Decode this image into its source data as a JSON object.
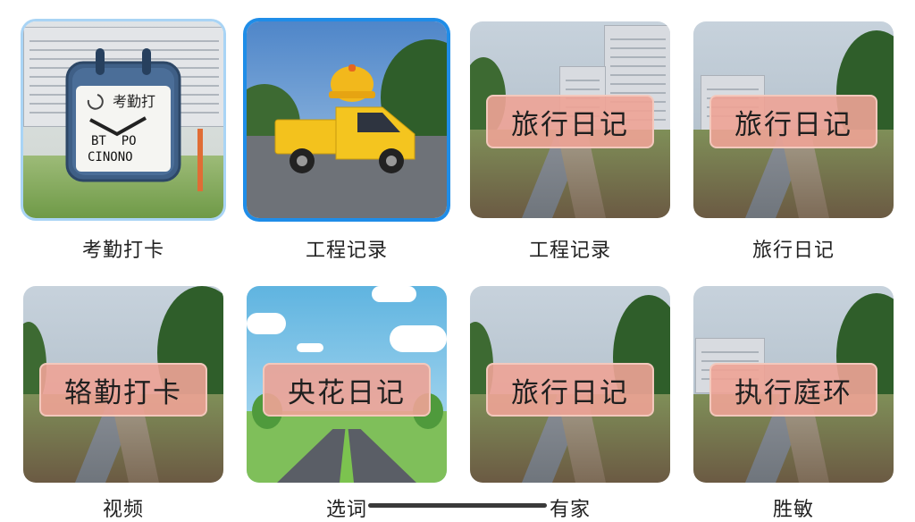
{
  "tiles": [
    {
      "label": "考勤打卡",
      "icon_text_1": "考勤打",
      "icon_text_2": "BT  PO",
      "icon_text_3": "CINONO"
    },
    {
      "label": "工程记录"
    },
    {
      "label": "工程记录",
      "banner": "旅行日记"
    },
    {
      "label": "旅行日记",
      "banner": "旅行日记"
    },
    {
      "label": "视频",
      "banner": "辂勤打卡"
    },
    {
      "label": "选词",
      "banner": "央花日记"
    },
    {
      "label": "有家",
      "banner": "旅行日记"
    },
    {
      "label": "胜敏",
      "banner": "执行庭环"
    }
  ],
  "colors": {
    "selected_border": "#1f8de8",
    "hover_border": "#a9d4f5",
    "banner": "#eea396"
  },
  "icons": {
    "calendar": "calendar-clock-icon",
    "truck": "yellow-truck-icon"
  }
}
